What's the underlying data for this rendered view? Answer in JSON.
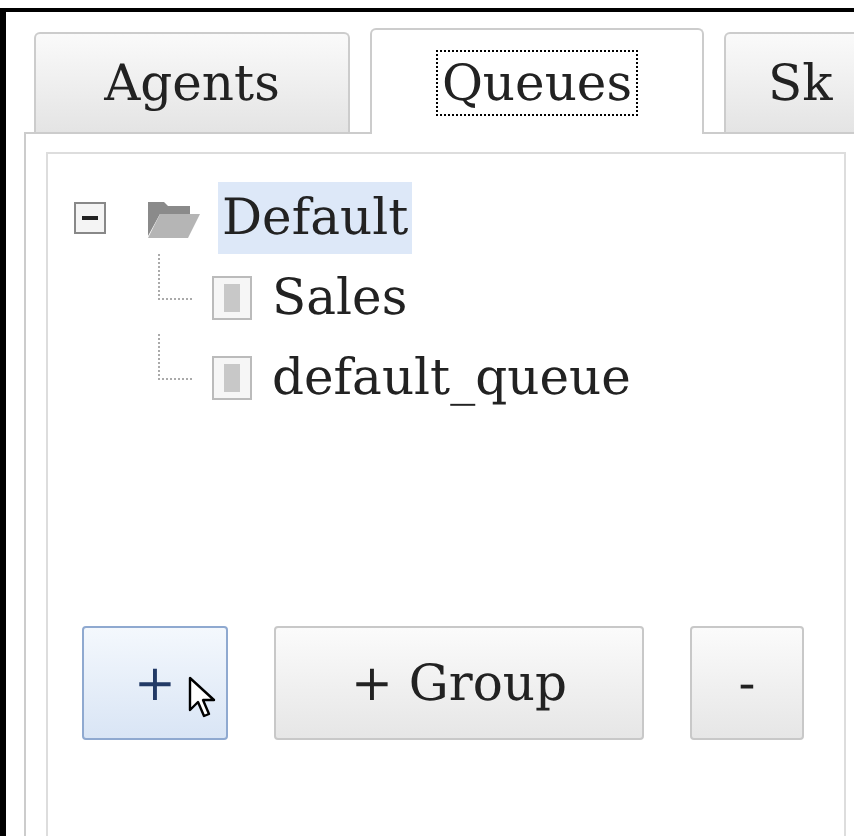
{
  "tabs": [
    {
      "label": "Agents",
      "selected": false,
      "focused": false
    },
    {
      "label": "Queues",
      "selected": true,
      "focused": true
    },
    {
      "label": "Sk",
      "selected": false,
      "focused": false
    }
  ],
  "tree": [
    {
      "label": "Default",
      "kind": "group",
      "expanded": true,
      "selected": true,
      "children": [
        {
          "label": "Sales",
          "kind": "queue",
          "selected": false
        },
        {
          "label": "default_queue",
          "kind": "queue",
          "selected": false
        }
      ]
    }
  ],
  "buttons": [
    {
      "label": "+",
      "hovered": true
    },
    {
      "label": "+ Group",
      "hovered": false
    },
    {
      "label": "-",
      "hovered": false
    }
  ]
}
